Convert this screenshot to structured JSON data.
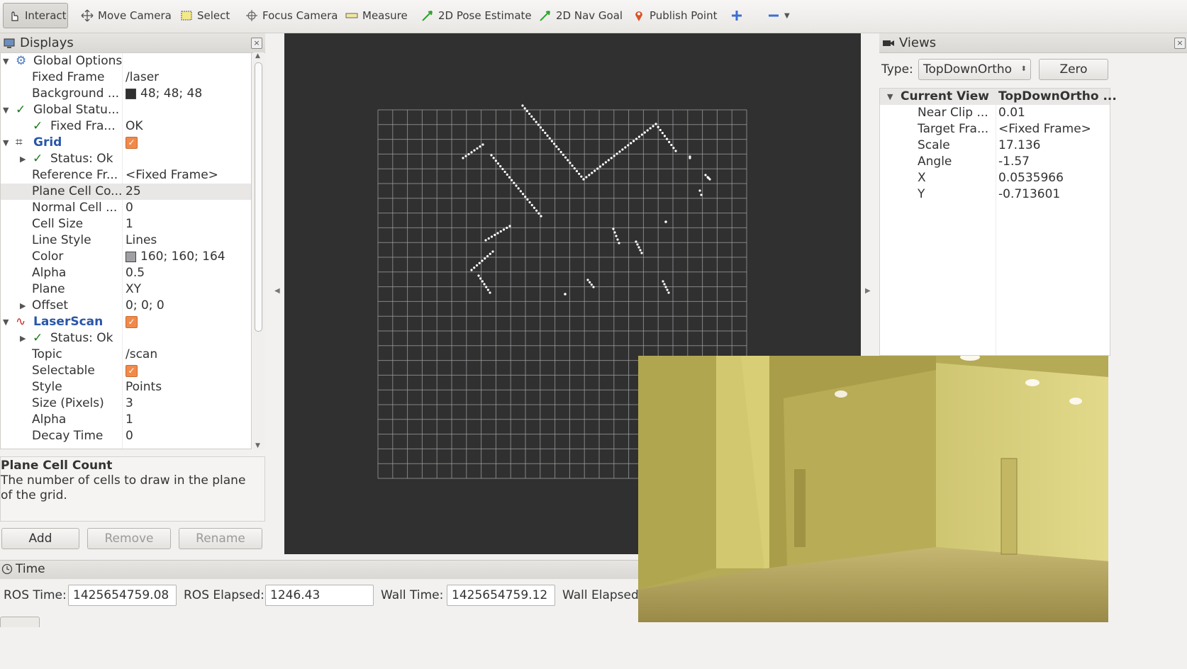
{
  "toolbar": {
    "items": [
      {
        "label": "Interact"
      },
      {
        "label": "Move Camera"
      },
      {
        "label": "Select"
      },
      {
        "label": "Focus Camera"
      },
      {
        "label": "Measure"
      },
      {
        "label": "2D Pose Estimate"
      },
      {
        "label": "2D Nav Goal"
      },
      {
        "label": "Publish Point"
      }
    ]
  },
  "displays": {
    "title": "Displays",
    "rows": [
      {
        "name": "Global Options",
        "value": ""
      },
      {
        "name": "Fixed Frame",
        "value": "/laser"
      },
      {
        "name": "Background ...",
        "value": "48; 48; 48"
      },
      {
        "name": "Global Statu...",
        "value": ""
      },
      {
        "name": "Fixed Fra...",
        "value": "OK"
      },
      {
        "name": "Grid",
        "value": ""
      },
      {
        "name": "Status: Ok",
        "value": ""
      },
      {
        "name": "Reference Fr...",
        "value": "<Fixed Frame>"
      },
      {
        "name": "Plane Cell Co...",
        "value": "25"
      },
      {
        "name": "Normal Cell ...",
        "value": "0"
      },
      {
        "name": "Cell Size",
        "value": "1"
      },
      {
        "name": "Line Style",
        "value": "Lines"
      },
      {
        "name": "Color",
        "value": "160; 160; 164"
      },
      {
        "name": "Alpha",
        "value": "0.5"
      },
      {
        "name": "Plane",
        "value": "XY"
      },
      {
        "name": "Offset",
        "value": "0; 0; 0"
      },
      {
        "name": "LaserScan",
        "value": ""
      },
      {
        "name": "Status: Ok",
        "value": ""
      },
      {
        "name": "Topic",
        "value": "/scan"
      },
      {
        "name": "Selectable",
        "value": ""
      },
      {
        "name": "Style",
        "value": "Points"
      },
      {
        "name": "Size (Pixels)",
        "value": "3"
      },
      {
        "name": "Alpha",
        "value": "1"
      },
      {
        "name": "Decay Time",
        "value": "0"
      }
    ],
    "description_title": "Plane Cell Count",
    "description_text": "The number of cells to draw in the plane of the grid.",
    "buttons": {
      "add": "Add",
      "remove": "Remove",
      "rename": "Rename"
    }
  },
  "views": {
    "title": "Views",
    "type_label": "Type:",
    "type_value": "TopDownOrtho",
    "zero_label": "Zero",
    "rows": [
      {
        "name": "Current View",
        "value": "TopDownOrtho ..."
      },
      {
        "name": "Near Clip ...",
        "value": "0.01"
      },
      {
        "name": "Target Fra...",
        "value": "<Fixed Frame>"
      },
      {
        "name": "Scale",
        "value": "17.136"
      },
      {
        "name": "Angle",
        "value": "-1.57"
      },
      {
        "name": "X",
        "value": "0.0535966"
      },
      {
        "name": "Y",
        "value": "-0.713601"
      }
    ]
  },
  "time": {
    "title": "Time",
    "ros_time_label": "ROS Time:",
    "ros_time": "1425654759.08",
    "ros_elapsed_label": "ROS Elapsed:",
    "ros_elapsed": "1246.43",
    "wall_time_label": "Wall Time:",
    "wall_time": "1425654759.12",
    "wall_elapsed_label": "Wall Elapsed:"
  },
  "colors": {
    "render_background": "#303030",
    "grid_color": "#a0a0a4",
    "checkbox": "#f08a4b"
  }
}
